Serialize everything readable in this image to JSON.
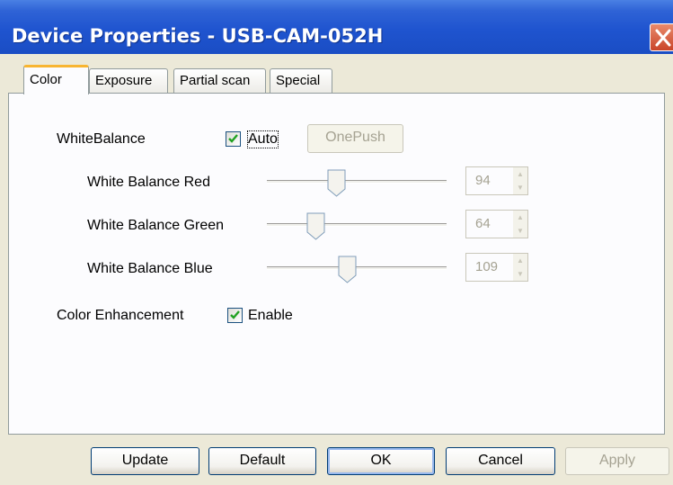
{
  "window": {
    "title": "Device Properties - USB-CAM-052H"
  },
  "tabs": [
    {
      "label": "Color",
      "active": true
    },
    {
      "label": "Exposure",
      "active": false
    },
    {
      "label": "Partial scan",
      "active": false
    },
    {
      "label": "Special",
      "active": false
    }
  ],
  "white_balance": {
    "label": "WhiteBalance",
    "auto_label": "Auto",
    "auto_checked": true,
    "onepush_label": "OnePush",
    "sliders": [
      {
        "label": "White Balance Red",
        "value": "94",
        "fraction": 0.38
      },
      {
        "label": "White Balance Green",
        "value": "64",
        "fraction": 0.26
      },
      {
        "label": "White Balance Blue",
        "value": "109",
        "fraction": 0.44
      }
    ]
  },
  "color_enhancement": {
    "label": "Color Enhancement",
    "enable_label": "Enable",
    "checked": true
  },
  "buttons": {
    "update": "Update",
    "default": "Default",
    "ok": "OK",
    "cancel": "Cancel",
    "apply": "Apply"
  },
  "colors": {
    "title_bar": "#1f54cf",
    "dialog_bg": "#ece9d8",
    "active_tab_accent": "#f8b531",
    "close_button": "#d9532f",
    "disabled_text": "#a5a292"
  }
}
